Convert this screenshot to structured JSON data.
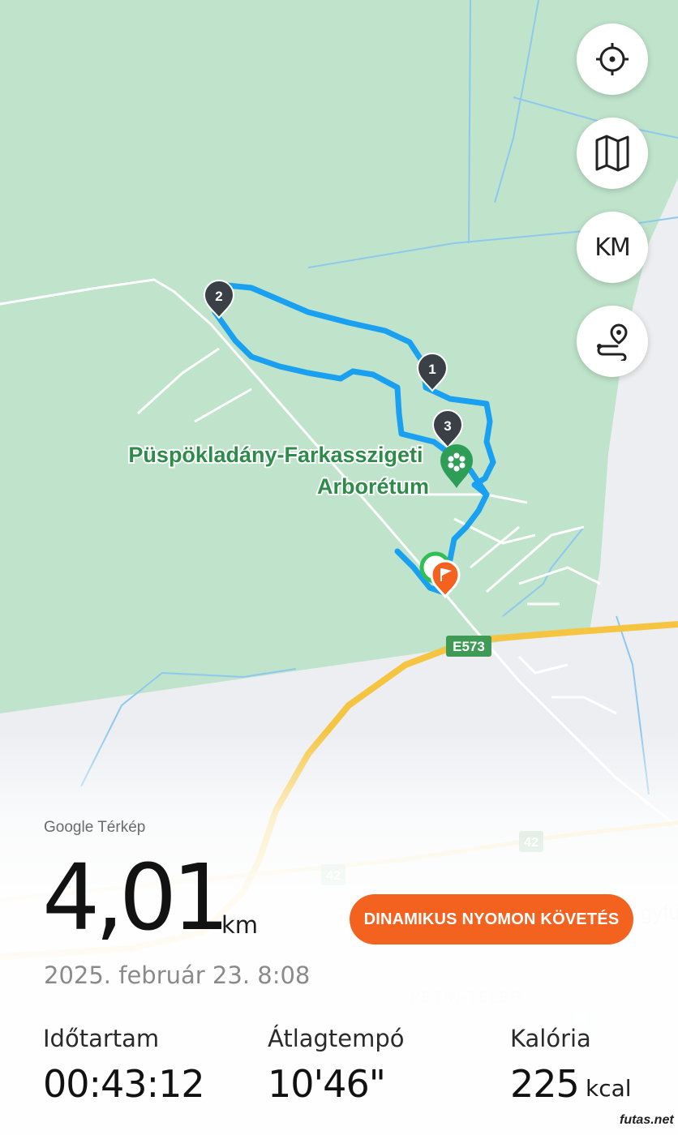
{
  "map": {
    "poi_name_line1": "Püspökladány-Farkasszigeti",
    "poi_name_line2": "Arborétum",
    "road_label_e573": "E573",
    "road_label_42_a": "42",
    "road_label_42_b": "42",
    "place_label_petri": "PETRI-TELEP",
    "place_label_partial": "gyfü",
    "markers": [
      "1",
      "2",
      "3"
    ],
    "colors": {
      "forest": "#bfe3cb",
      "route": "#1aa0f0",
      "highway": "#f5c542",
      "label_green": "#2e8b4a"
    }
  },
  "controls": {
    "locate_icon": "crosshair-icon",
    "map_type_icon": "map-icon",
    "unit_label": "KM",
    "route_icon": "route-pin-icon"
  },
  "summary": {
    "attribution": "Google Térkép",
    "distance": "4,01",
    "distance_unit": "km",
    "date": "2025. február 23. 8:08",
    "tracking_button": "DINAMIKUS NYOMON KÖVETÉS",
    "accent_color": "#f4621f"
  },
  "stats": {
    "duration_label": "Időtartam",
    "duration_value": "00:43:12",
    "pace_label": "Átlagtempó",
    "pace_value": "10'46\"",
    "calories_label": "Kalória",
    "calories_value": "225",
    "calories_unit": "kcal"
  },
  "watermark": "futas.net"
}
